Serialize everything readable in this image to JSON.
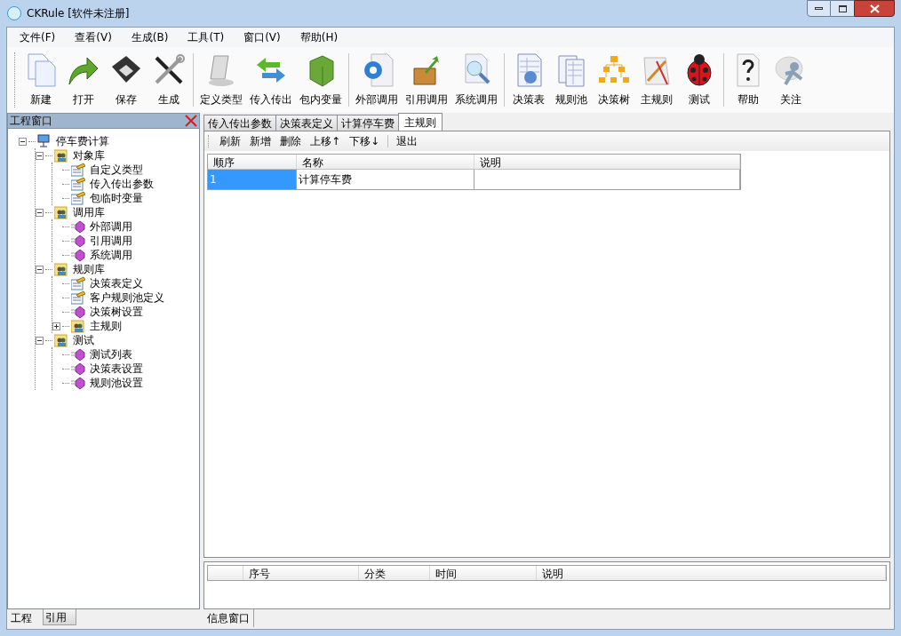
{
  "window": {
    "title": "CKRule [软件未注册]"
  },
  "menu": [
    "文件(F)",
    "查看(V)",
    "生成(B)",
    "工具(T)",
    "窗口(V)",
    "帮助(H)"
  ],
  "toolbar": [
    [
      "新建",
      "打开",
      "保存",
      "生成"
    ],
    [
      "定义类型",
      "传入传出",
      "包内变量"
    ],
    [
      "外部调用",
      "引用调用",
      "系统调用"
    ],
    [
      "决策表",
      "规则池",
      "决策树",
      "主规则",
      "测试"
    ],
    [
      "帮助",
      "关注"
    ]
  ],
  "project_panel": {
    "title": "工程窗口",
    "tree": [
      {
        "label": "停车费计算",
        "kind": "project",
        "expanded": true,
        "children": [
          {
            "label": "对象库",
            "kind": "folder",
            "expanded": true,
            "children": [
              {
                "label": "自定义类型",
                "kind": "form"
              },
              {
                "label": "传入传出参数",
                "kind": "form"
              },
              {
                "label": "包临时变量",
                "kind": "form"
              }
            ]
          },
          {
            "label": "调用库",
            "kind": "folder",
            "expanded": true,
            "children": [
              {
                "label": "外部调用",
                "kind": "gem"
              },
              {
                "label": "引用调用",
                "kind": "gem"
              },
              {
                "label": "系统调用",
                "kind": "gem"
              }
            ]
          },
          {
            "label": "规则库",
            "kind": "folder",
            "expanded": true,
            "children": [
              {
                "label": "决策表定义",
                "kind": "form"
              },
              {
                "label": "客户规则池定义",
                "kind": "form"
              },
              {
                "label": "决策树设置",
                "kind": "gem"
              },
              {
                "label": "主规则",
                "kind": "folder",
                "expanded": false
              }
            ]
          },
          {
            "label": "测试",
            "kind": "folder",
            "expanded": true,
            "children": [
              {
                "label": "测试列表",
                "kind": "gem"
              },
              {
                "label": "决策表设置",
                "kind": "gem"
              },
              {
                "label": "规则池设置",
                "kind": "gem"
              }
            ]
          }
        ]
      }
    ],
    "tabs": [
      {
        "label": "工程",
        "selected": true
      },
      {
        "label": "引用",
        "selected": false
      }
    ]
  },
  "doc_tabs": [
    {
      "label": "传入传出参数",
      "selected": false
    },
    {
      "label": "决策表定义",
      "selected": false
    },
    {
      "label": "计算停车费",
      "selected": false
    },
    {
      "label": "主规则",
      "selected": true
    }
  ],
  "actions": [
    [
      "刷新",
      "新增",
      "删除",
      "上移↑",
      "下移↓"
    ],
    [
      "退出"
    ]
  ],
  "table": {
    "columns": [
      "顺序",
      "名称",
      "说明"
    ],
    "rows": [
      {
        "cells": [
          "1",
          "计算停车费",
          ""
        ],
        "selected": true
      }
    ]
  },
  "info_panel": {
    "columns": [
      "序号",
      "分类",
      "时间",
      "说明"
    ],
    "tabs": [
      {
        "label": "信息窗口",
        "selected": true
      }
    ]
  }
}
